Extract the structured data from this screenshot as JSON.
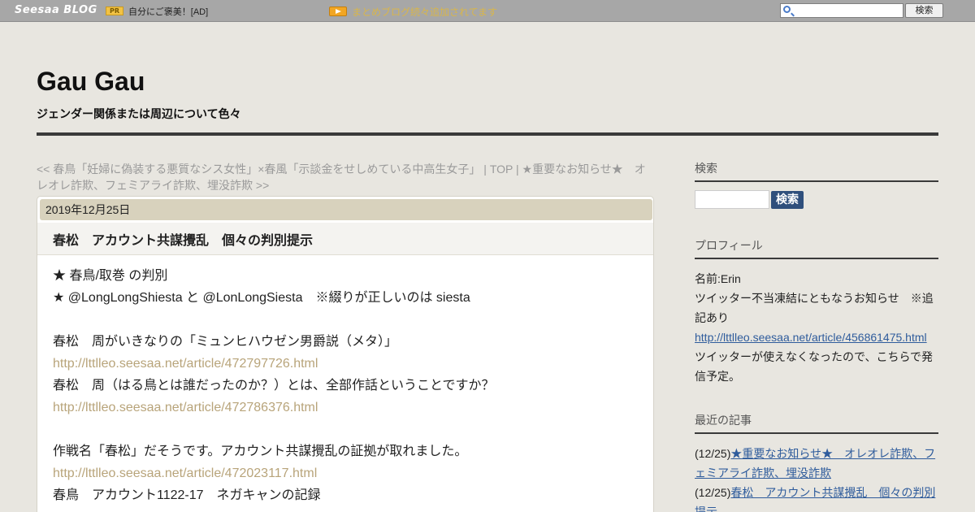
{
  "topbar": {
    "brand": "Seesaa BLOG",
    "pr_badge": "PR",
    "pr_text": "自分にご褒美！[AD]",
    "notice_text": "まとめブログ続々追加されてます",
    "search_button": "検索",
    "search_placeholder": ""
  },
  "header": {
    "title": "Gau Gau",
    "tagline": "ジェンダー関係または周辺について色々"
  },
  "article_nav": {
    "prev": "<< 春鳥「妊婦に偽装する悪質なシス女性」×春風「示談金をせしめている中高生女子」",
    "top": " | TOP | ",
    "next": "★重要なお知らせ★　オレオレ詐欺、フェミアライ詐欺、埋没詐欺 >>"
  },
  "article": {
    "date": "2019年12月25日",
    "title": "春松　アカウント共謀攪乱　個々の判別提示",
    "lines": [
      {
        "text": "★ 春鳥/取巻 の判別",
        "link": false
      },
      {
        "text": "★ @LongLongShiesta と @LonLongSiesta　※綴りが正しいのは siesta",
        "link": false
      },
      {
        "text": "",
        "link": false
      },
      {
        "text": "春松　周がいきなりの「ミュンヒハウゼン男爵説（メタ）」",
        "link": false
      },
      {
        "text": "http://lttlleo.seesaa.net/article/472797726.html",
        "link": true
      },
      {
        "text": "春松　周（はる鳥とは誰だったのか？）とは、全部作話ということですか？",
        "link": false
      },
      {
        "text": "http://lttlleo.seesaa.net/article/472786376.html",
        "link": true
      },
      {
        "text": "",
        "link": false
      },
      {
        "text": "作戦名「春松」だそうです。アカウント共謀攪乱の証拠が取れました。",
        "link": false
      },
      {
        "text": "http://lttlleo.seesaa.net/article/472023117.html",
        "link": true
      },
      {
        "text": "春鳥　アカウント1122-17　ネガキャンの記録",
        "link": false
      }
    ]
  },
  "sidebar": {
    "search": {
      "heading": "検索",
      "button": "検索"
    },
    "profile": {
      "heading": "プロフィール",
      "name": "名前:Erin",
      "notice": "ツイッター不当凍結にともなうお知らせ　※追記あり",
      "link": "http://lttlleo.seesaa.net/article/456861475.html",
      "note": "ツイッターが使えなくなったので、こちらで発信予定。"
    },
    "recent": {
      "heading": "最近の記事",
      "items": [
        {
          "date": "(12/25)",
          "title": "★重要なお知らせ★　オレオレ詐欺、フェミアライ詐欺、埋没詐欺"
        },
        {
          "date": "(12/25)",
          "title": "春松　アカウント共謀攪乱　個々の判別提示"
        }
      ]
    }
  }
}
